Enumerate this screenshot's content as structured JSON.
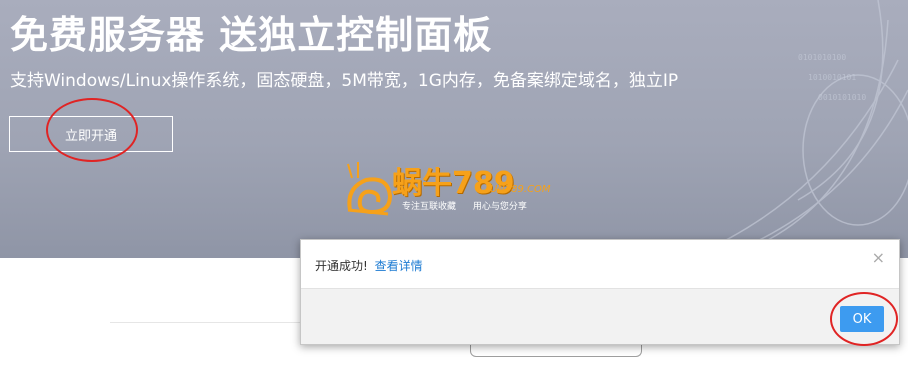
{
  "hero": {
    "title": "免费服务器 送独立控制面板",
    "subtitle": "支持Windows/Linux操作系统，固态硬盘，5M带宽，1G内存，免备案绑定域名，独立IP",
    "cta_label": "立即开通",
    "background_color": "#a4a9b9"
  },
  "watermark": {
    "brand": "蜗牛789",
    "url": "UN789.COM",
    "slogan_left": "专注互联收藏",
    "slogan_right": "用心与您分享",
    "color": "#f6a11a"
  },
  "dialog": {
    "message": "开通成功!",
    "link_label": "查看详情",
    "close_icon": "×",
    "ok_label": "OK",
    "accent_color": "#3d9bf0"
  },
  "annotations": {
    "circle_color": "#e02424"
  }
}
